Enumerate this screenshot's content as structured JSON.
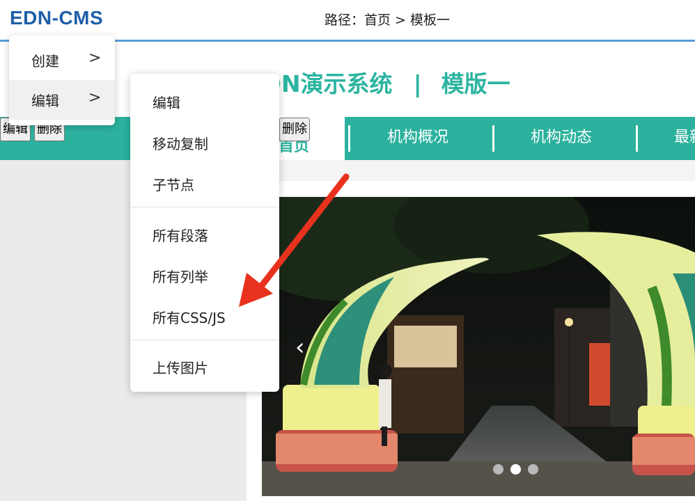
{
  "topbar": {
    "brand": "EDN-CMS",
    "breadcrumb": "路径：首页 > 模板一"
  },
  "site": {
    "title_left": "EDN演示系统",
    "title_sep": "|",
    "title_right": "模版一"
  },
  "nav": {
    "active_label": "首页",
    "items": [
      "机构概况",
      "机构动态",
      "最新"
    ]
  },
  "buttons": {
    "edit": "编辑",
    "delete": "删除",
    "delete2": "删除"
  },
  "carousel": {
    "prev_glyph": "‹",
    "slide_count": 3,
    "active_index": 1
  },
  "context_menu": {
    "items": [
      {
        "label": "创建",
        "chevron": ">"
      },
      {
        "label": "编辑",
        "chevron": ">"
      }
    ]
  },
  "submenu": {
    "group1": [
      "编辑",
      "移动复制",
      "子节点"
    ],
    "group2": [
      "所有段落",
      "所有列举",
      "所有CSS/JS"
    ],
    "group3": [
      "上传图片"
    ]
  },
  "colors": {
    "accent": "#2bb19d",
    "brand": "#1f5fa8",
    "annotation_arrow": "#e8321e"
  }
}
